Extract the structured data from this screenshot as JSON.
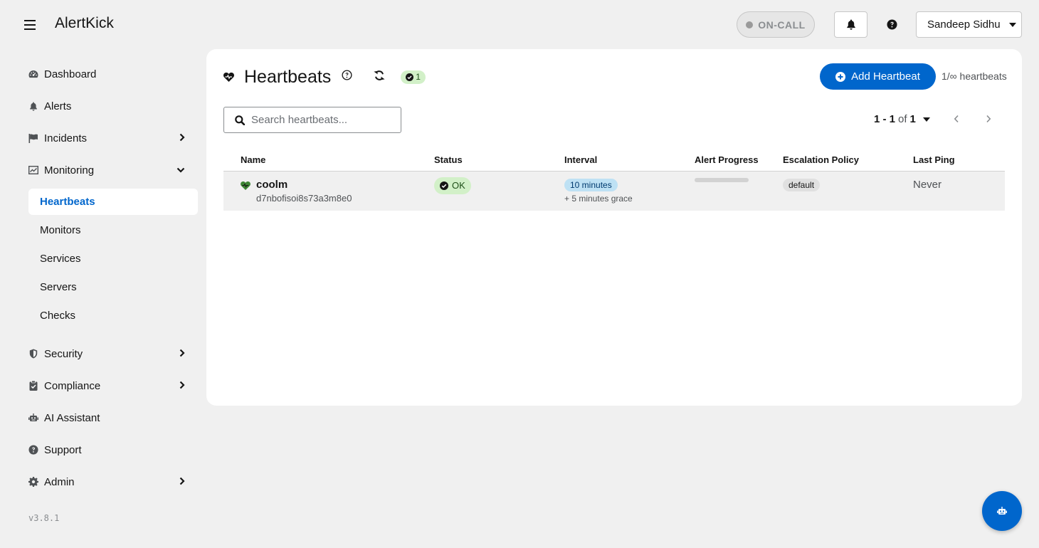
{
  "header": {
    "brand": "AlertKick",
    "oncall_label": "ON-CALL",
    "user_name": "Sandeep Sidhu"
  },
  "sidebar": {
    "items": [
      {
        "label": "Dashboard",
        "icon": "dashboard-icon"
      },
      {
        "label": "Alerts",
        "icon": "bell-icon"
      },
      {
        "label": "Incidents",
        "icon": "flag-icon"
      },
      {
        "label": "Monitoring",
        "icon": "monitoring-chart-icon"
      },
      {
        "label": "Security",
        "icon": "shield-icon"
      },
      {
        "label": "Compliance",
        "icon": "clipboard-check-icon"
      },
      {
        "label": "AI Assistant",
        "icon": "robot-icon"
      },
      {
        "label": "Support",
        "icon": "question-circle-icon"
      },
      {
        "label": "Admin",
        "icon": "gear-icon"
      }
    ],
    "monitoring_sub": [
      "Heartbeats",
      "Monitors",
      "Services",
      "Servers",
      "Checks"
    ],
    "version": "v3.8.1"
  },
  "main": {
    "title": "Heartbeats",
    "ok_count": "1",
    "add_button": "Add Heartbeat",
    "quota": "1/∞ heartbeats",
    "search_placeholder": "Search heartbeats...",
    "pager": {
      "range": "1 - 1",
      "of": "of",
      "total": "1"
    },
    "columns": [
      "Name",
      "Status",
      "Interval",
      "Alert Progress",
      "Escalation Policy",
      "Last Ping"
    ],
    "rows": [
      {
        "name": "coolm",
        "id": "d7nbofisoi8s73a3m8e0",
        "status": "OK",
        "interval": "10 minutes",
        "grace": "+ 5 minutes grace",
        "alert_progress": 0,
        "policy": "default",
        "last_ping": "Never"
      }
    ]
  },
  "colors": {
    "accent": "#0066cc",
    "ok_bg": "#d2f0c8",
    "ok_fg": "#1e4f18",
    "heart": "#3e8635"
  }
}
